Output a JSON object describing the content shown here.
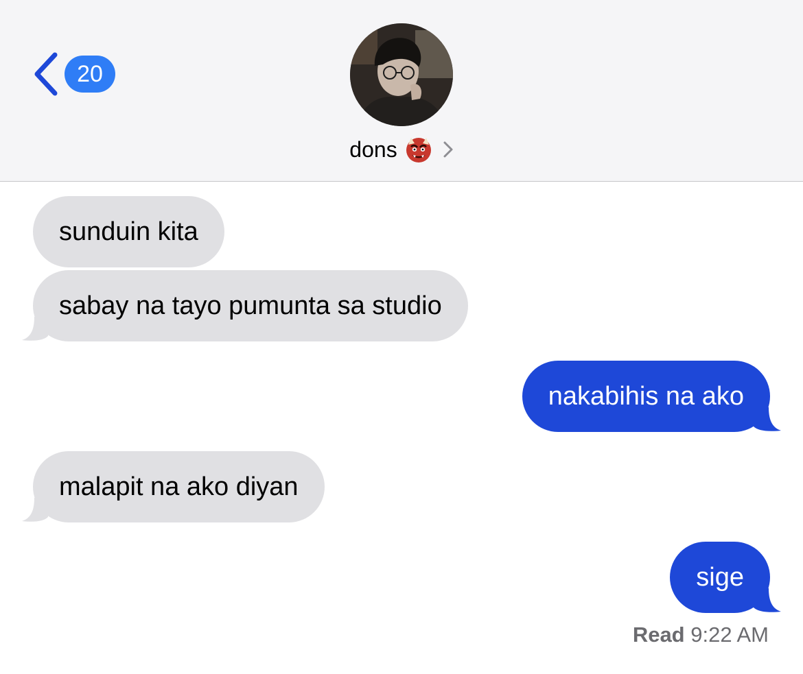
{
  "header": {
    "unread_count": "20",
    "contact_name": "dons",
    "contact_emoji_icon": "red-ogre-emoji",
    "back_icon": "chevron-left-icon",
    "disclosure_icon": "chevron-right-icon"
  },
  "messages": [
    {
      "direction": "received",
      "text": "sunduin kita"
    },
    {
      "direction": "received",
      "text": "sabay na tayo pumunta sa studio"
    },
    {
      "direction": "sent",
      "text": "nakabihis na ako"
    },
    {
      "direction": "received",
      "text": "malapit na ako diyan"
    },
    {
      "direction": "sent",
      "text": "sige"
    }
  ],
  "receipt": {
    "status": "Read",
    "time": "9:22 AM"
  },
  "colors": {
    "sent_bubble": "#1e48d8",
    "received_bubble": "#e0e0e3",
    "badge": "#2f7df6",
    "back_arrow": "#1e48d8"
  }
}
